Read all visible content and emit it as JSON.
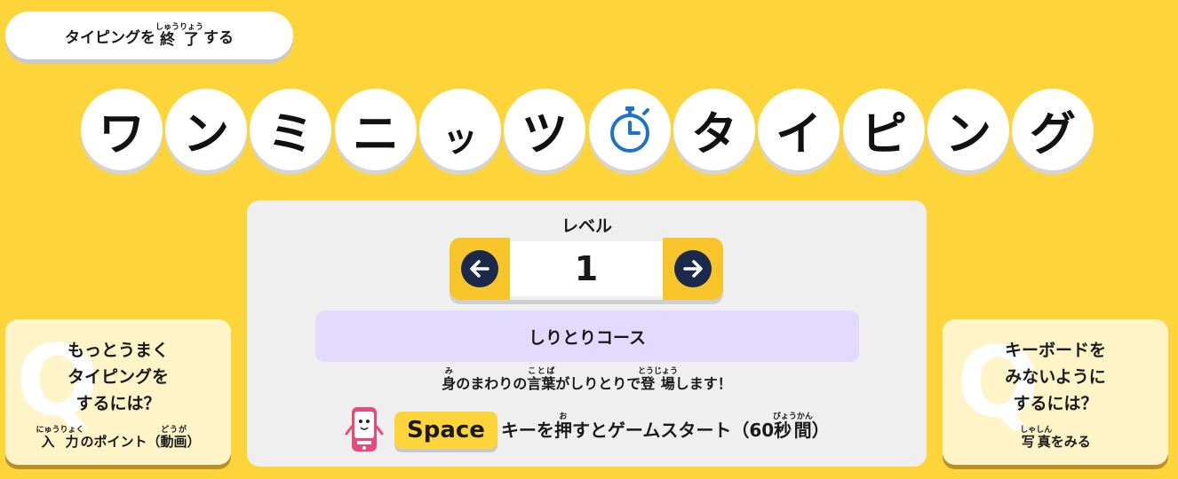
{
  "exit_button": {
    "label_pre": "タイピングを",
    "label_ruby_base": "終了",
    "label_ruby_text": "しゅうりょう",
    "label_post": "する"
  },
  "title": {
    "chars": [
      "ワ",
      "ン",
      "ミ",
      "ニ",
      "ッ",
      "ツ",
      "タ",
      "イ",
      "ピ",
      "ン",
      "グ"
    ],
    "timer_icon": "stopwatch-icon",
    "timer_color": "#1e73c8"
  },
  "level": {
    "label": "レベル",
    "value": "1",
    "prev_icon": "arrow-left-icon",
    "next_icon": "arrow-right-icon"
  },
  "course": {
    "name": "しりとりコース"
  },
  "description": {
    "segments": [
      {
        "base": "身",
        "ruby": "み"
      },
      {
        "text": "のまわりの"
      },
      {
        "base": "言葉",
        "ruby": "ことば"
      },
      {
        "text": "がしりとりで"
      },
      {
        "base": "登場",
        "ruby": "とうじょう"
      },
      {
        "text": "します！"
      }
    ]
  },
  "start": {
    "key_label": "Space",
    "text_pre": "キーを",
    "push_base": "押",
    "push_ruby": "お",
    "text_mid": "すとゲームスタート（60",
    "time_base": "秒間",
    "time_ruby": "びょうかん",
    "text_post": "）"
  },
  "help_left": {
    "title_lines": [
      "もっとうまく",
      "タイピングを",
      "するには？"
    ],
    "link_ruby_base": "入力",
    "link_ruby_text": "にゅうりょく",
    "link_mid": "のポイント（",
    "link_ruby2_base": "動画",
    "link_ruby2_text": "どうが",
    "link_post": "）",
    "icon": "q-icon"
  },
  "help_right": {
    "title_lines": [
      "キーボードを",
      "みないように",
      "するには？"
    ],
    "link_ruby_base": "写真",
    "link_ruby_text": "しゃしん",
    "link_post": "をみる",
    "icon": "q-icon"
  },
  "colors": {
    "background": "#fdd43a",
    "accent_button": "#f7c52a",
    "arrow": "#1b2a4a",
    "course_bg": "#e3dbff"
  }
}
